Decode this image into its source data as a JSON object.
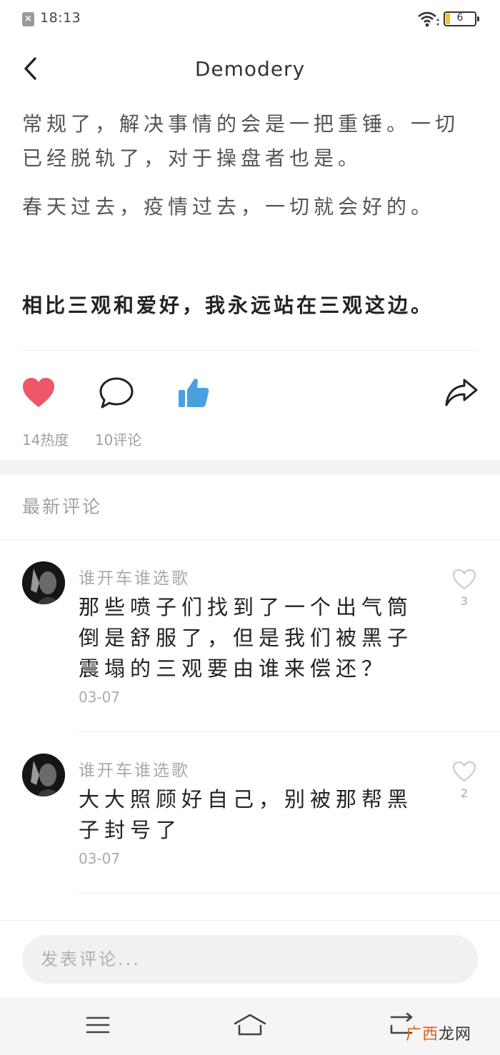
{
  "status_bar": {
    "time": "18:13",
    "battery": "6",
    "notification_icon": "close-box-icon"
  },
  "header": {
    "title": "Demodery"
  },
  "article": {
    "paragraphs": [
      "常规了，解决事情的会是一把重锤。一切已经脱轨了，对于操盘者也是。",
      "春天过去，疫情过去，一切就会好的。"
    ],
    "bold_line": "相比三观和爱好，我永远站在三观这边。"
  },
  "actions": {
    "heat": "14热度",
    "comments": "10评论",
    "colors": {
      "heart": "#f0566a",
      "thumb": "#4a9fe0"
    }
  },
  "comments_section": {
    "title": "最新评论",
    "items": [
      {
        "user": "谁开车谁选歌",
        "text": "那些喷子们找到了一个出气筒倒是舒服了，但是我们被黑子震塌的三观要由谁来偿还？",
        "date": "03-07",
        "likes": "3"
      },
      {
        "user": "谁开车谁选歌",
        "text": "大大照顾好自己，别被那帮黑子封号了",
        "date": "03-07",
        "likes": "2"
      }
    ]
  },
  "input": {
    "placeholder": "发表评论..."
  },
  "watermark": {
    "part1": "广西",
    "part2": "龙网"
  }
}
